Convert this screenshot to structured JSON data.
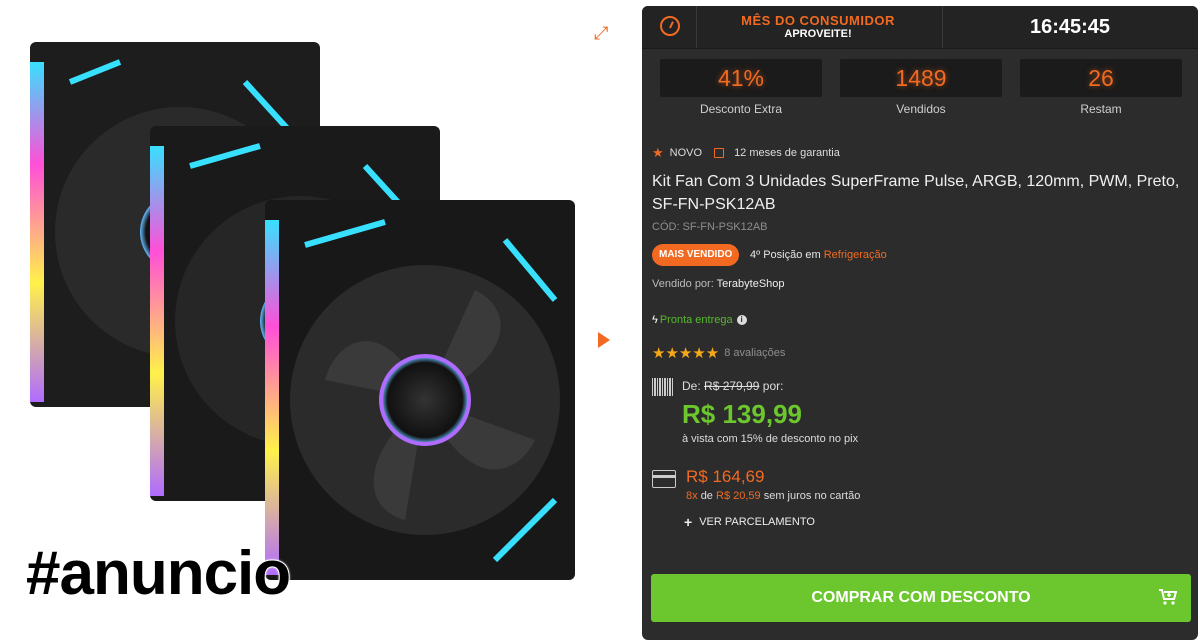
{
  "watermark": "#anuncio",
  "promo": {
    "title": "MÊS DO CONSUMIDOR",
    "subtitle": "APROVEITE!",
    "clock": "16:45:45"
  },
  "stats": [
    {
      "value": "41%",
      "label": "Desconto Extra"
    },
    {
      "value": "1489",
      "label": "Vendidos"
    },
    {
      "value": "26",
      "label": "Restam"
    }
  ],
  "product": {
    "tag_new": "NOVO",
    "warranty": "12 meses de garantia",
    "title": "Kit Fan Com 3 Unidades SuperFrame Pulse, ARGB, 120mm, PWM, Preto, SF-FN-PSK12AB",
    "code": "CÓD: SF-FN-PSK12AB",
    "best_seller": "MAIS VENDIDO",
    "rank_text": "4º Posição em",
    "rank_category": "Refrigeração",
    "seller_label": "Vendido por:",
    "seller_name": "TerabyteShop",
    "stock": "Pronta entrega",
    "stars": "★★★★★",
    "reviews": "8 avaliações"
  },
  "pricing": {
    "from_label": "De:",
    "old_price": "R$ 279,99",
    "per_label": "por:",
    "pix_price": "R$ 139,99",
    "pix_note": "à vista com 15% de desconto no pix",
    "card_price": "R$ 164,69",
    "installments_count": "8x",
    "installments_de": "de",
    "installment_value": "R$ 20,59",
    "installments_note": "sem juros no cartão",
    "parcel_link": "VER PARCELAMENTO"
  },
  "buy_button": "COMPRAR COM DESCONTO",
  "colors": {
    "accent": "#f26a21",
    "buy": "#6cc62e",
    "panel": "#2c2c2c"
  }
}
